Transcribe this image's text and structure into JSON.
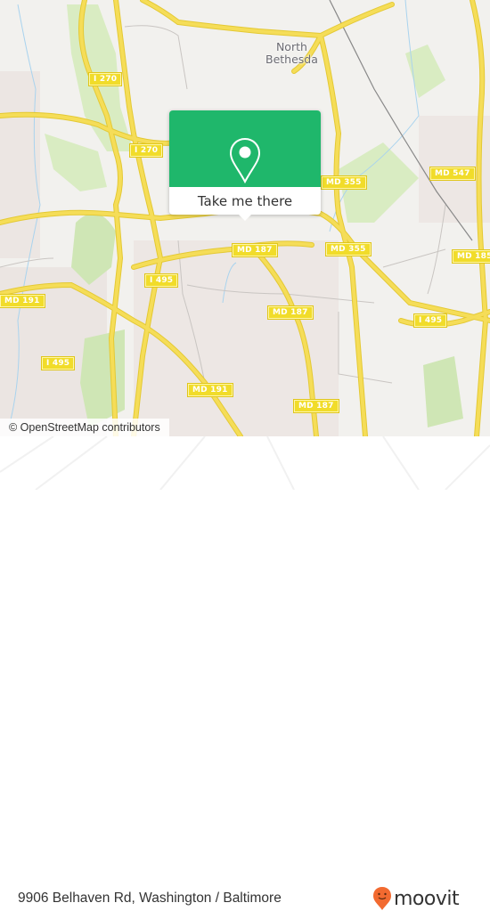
{
  "map": {
    "place_labels": [
      {
        "id": "north-bethesda",
        "lines": [
          "North",
          "Bethesda"
        ]
      }
    ],
    "road_shields": [
      {
        "id": "i270-a",
        "label": "I 270"
      },
      {
        "id": "i270-b",
        "label": "I 270"
      },
      {
        "id": "md355-a",
        "label": "MD 355"
      },
      {
        "id": "md547",
        "label": "MD 547"
      },
      {
        "id": "md355-b",
        "label": "MD 355"
      },
      {
        "id": "md185",
        "label": "MD 185"
      },
      {
        "id": "md187-a",
        "label": "MD 187"
      },
      {
        "id": "i495-a",
        "label": "I 495"
      },
      {
        "id": "md191-a",
        "label": "MD 191"
      },
      {
        "id": "md187-b",
        "label": "MD 187"
      },
      {
        "id": "i495-b",
        "label": "I 495"
      },
      {
        "id": "i495-c",
        "label": "I 495"
      },
      {
        "id": "md191-b",
        "label": "MD 191"
      },
      {
        "id": "md187-c",
        "label": "MD 187"
      }
    ],
    "colors": {
      "land": "#f2f1ee",
      "park": "#d9ecc2",
      "road_major": "#f5dd58",
      "water": "#a9d3ee"
    }
  },
  "popup": {
    "icon": "map-pin-icon",
    "button_label": "Take me there",
    "color": "#1fb76b"
  },
  "attribution": "© OpenStreetMap contributors",
  "footer": {
    "address": "9906 Belhaven Rd, Washington / Baltimore",
    "brand": "moovit",
    "brand_color": "#f26a30"
  }
}
